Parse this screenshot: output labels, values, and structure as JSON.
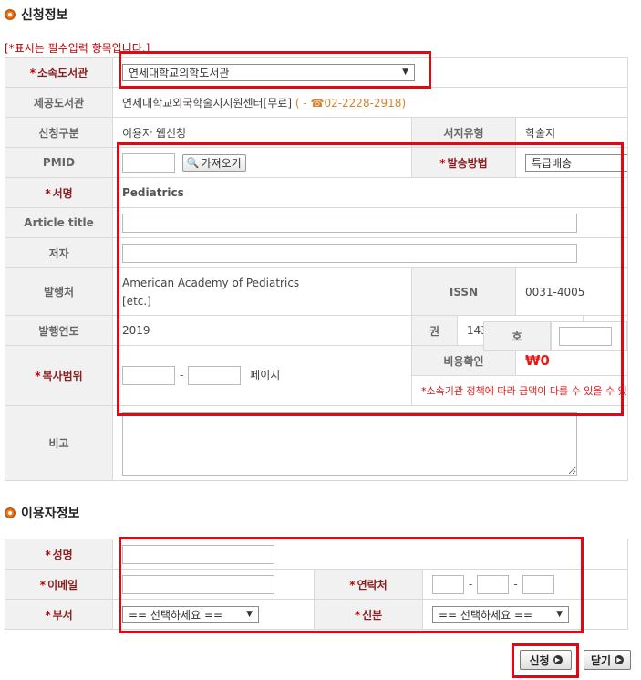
{
  "sections": {
    "request_info_title": "신청정보",
    "user_info_title": "이용자정보"
  },
  "required_note": "[*표시는 필수입력 항목입니다.]",
  "request_form": {
    "library": {
      "label": "소속도서관",
      "value": "연세대학교의학도서관"
    },
    "provider": {
      "label": "제공도서관",
      "value": "연세대학교외국학술지지원센터[무료]",
      "phone_prefix": "( - ☎",
      "phone": "02-2228-2918)"
    },
    "request_type": {
      "label": "신청구분",
      "value": "이용자 웹신청"
    },
    "doc_type": {
      "label": "서지유형",
      "value": "학술지"
    },
    "pmid": {
      "label": "PMID",
      "value": "",
      "fetch_label": "가져오기"
    },
    "delivery": {
      "label": "발송방법",
      "value": "특급배송"
    },
    "journal": {
      "label": "서명",
      "value": "Pediatrics"
    },
    "article_title": {
      "label": "Article title",
      "value": ""
    },
    "author": {
      "label": "저자",
      "value": ""
    },
    "publisher": {
      "label": "발행처",
      "line1": "American Academy of Pediatrics",
      "line2": "[etc.]"
    },
    "issn": {
      "label": "ISSN",
      "value": "0031-4005"
    },
    "year": {
      "label": "발행연도",
      "value": "2019"
    },
    "volume": {
      "label": "권",
      "value": "143"
    },
    "issue": {
      "label": "호",
      "value": ""
    },
    "copy_range": {
      "label": "복사범위",
      "start": "",
      "end": "",
      "unit": "페이지"
    },
    "cost": {
      "label": "비용확인",
      "value": "₩0",
      "note": "소속기관 정책에 따라 금액이 다를 수 있을 수 있습니다."
    },
    "remarks": {
      "label": "비고",
      "value": ""
    }
  },
  "user_form": {
    "name": {
      "label": "성명",
      "value": ""
    },
    "email": {
      "label": "이메일",
      "value": ""
    },
    "contact": {
      "label": "연락처",
      "part1": "",
      "part2": "",
      "part3": ""
    },
    "department": {
      "label": "부서",
      "value": "== 선택하세요 =="
    },
    "status": {
      "label": "신분",
      "value": "== 선택하세요 =="
    }
  },
  "buttons": {
    "submit": "신청",
    "close": "닫기"
  },
  "colors": {
    "highlight_box": "#e30613",
    "label_bg": "#f1f1f1",
    "required_star": "#c00000",
    "price": "#e31b1b",
    "phone": "#d9822b",
    "bullet": "#f07c1e"
  },
  "icons": {
    "section_bullet": "orange-bullet-icon",
    "fetch": "magnifier-icon",
    "phone": "telephone-icon",
    "select_arrow": "triangle-down-icon",
    "button_go": "circle-arrow-icon"
  }
}
